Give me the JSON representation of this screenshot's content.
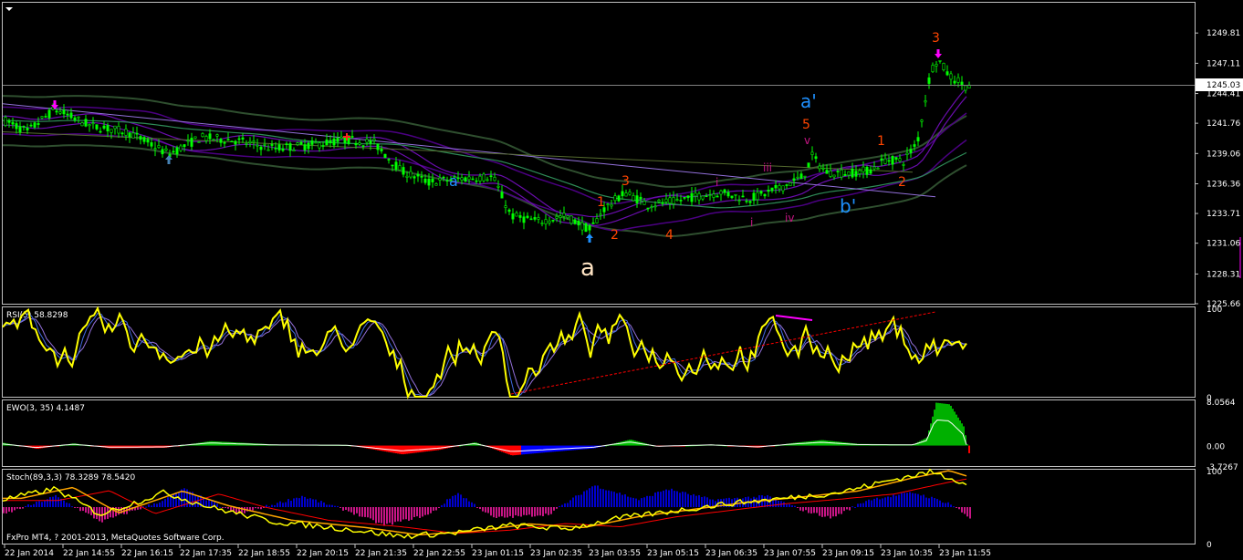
{
  "chart_data": [
    {
      "type": "line",
      "name": "price",
      "ylim": [
        1225.66,
        1252.51
      ],
      "y_ticks": [
        "1249.81",
        "1247.11",
        "1244.41",
        "1241.76",
        "1239.06",
        "1236.36",
        "1233.71",
        "1231.06",
        "1228.31",
        "1225.66"
      ],
      "current_price": "1245.03",
      "wave_labels": [
        {
          "text": "a",
          "color": "#ffe4c4"
        },
        {
          "text": "a'",
          "color": "#1e90ff"
        },
        {
          "text": "b'",
          "color": "#1e90ff"
        },
        {
          "text": "1",
          "color": "#ff4500"
        },
        {
          "text": "2",
          "color": "#ff4500"
        },
        {
          "text": "3",
          "color": "#ff4500"
        },
        {
          "text": "4",
          "color": "#ff4500"
        },
        {
          "text": "5",
          "color": "#ff4500"
        },
        {
          "text": "1",
          "color": "#ff4500"
        },
        {
          "text": "2",
          "color": "#ff4500"
        },
        {
          "text": "3",
          "color": "#ff4500"
        },
        {
          "text": "i",
          "color": "#c71585"
        },
        {
          "text": "i",
          "color": "#c71585"
        },
        {
          "text": "iii",
          "color": "#c71585"
        },
        {
          "text": "iv",
          "color": "#c71585"
        },
        {
          "text": "v",
          "color": "#c71585"
        },
        {
          "text": "a",
          "color": "#1e90ff"
        }
      ]
    },
    {
      "type": "line",
      "name": "rsi",
      "label": "RSI(5) 58.8298",
      "ylim": [
        0,
        100
      ],
      "y_ticks": [
        "100",
        "0"
      ]
    },
    {
      "type": "bar",
      "name": "ewo",
      "label": "EWO(3, 35) 4.1487",
      "ylim": [
        -3.7267,
        8.0564
      ],
      "y_ticks": [
        "8.0564",
        "0.00",
        "-3.7267"
      ]
    },
    {
      "type": "line",
      "name": "stoch",
      "label": "Stoch(89,3,3) 78.3289 78.5420",
      "ylim": [
        0,
        100
      ],
      "y_ticks": [
        "100",
        "0"
      ]
    }
  ],
  "time_axis": [
    "22 Jan 2014",
    "22 Jan 14:55",
    "22 Jan 16:15",
    "22 Jan 17:35",
    "22 Jan 18:55",
    "22 Jan 20:15",
    "22 Jan 21:35",
    "22 Jan 22:55",
    "23 Jan 01:15",
    "23 Jan 02:35",
    "23 Jan 03:55",
    "23 Jan 05:15",
    "23 Jan 06:35",
    "23 Jan 07:55",
    "23 Jan 09:15",
    "23 Jan 10:35",
    "23 Jan 11:55"
  ],
  "copyright": "FxPro MT4, ? 2001-2013, MetaQuotes Software Corp.",
  "colors": {
    "candle": "#00ff00",
    "rsi": "#ffff00",
    "ewo_pos": "#00c000",
    "ewo_neg": "#ff0000",
    "ewo_blue": "#0000ff",
    "stoch_hist_pos": "#0000cd",
    "stoch_hist_neg": "#c71585",
    "grid": "#c0c0c0"
  },
  "icons": [
    "menu-triangle-icon",
    "up-arrow-icon",
    "down-arrow-icon"
  ]
}
